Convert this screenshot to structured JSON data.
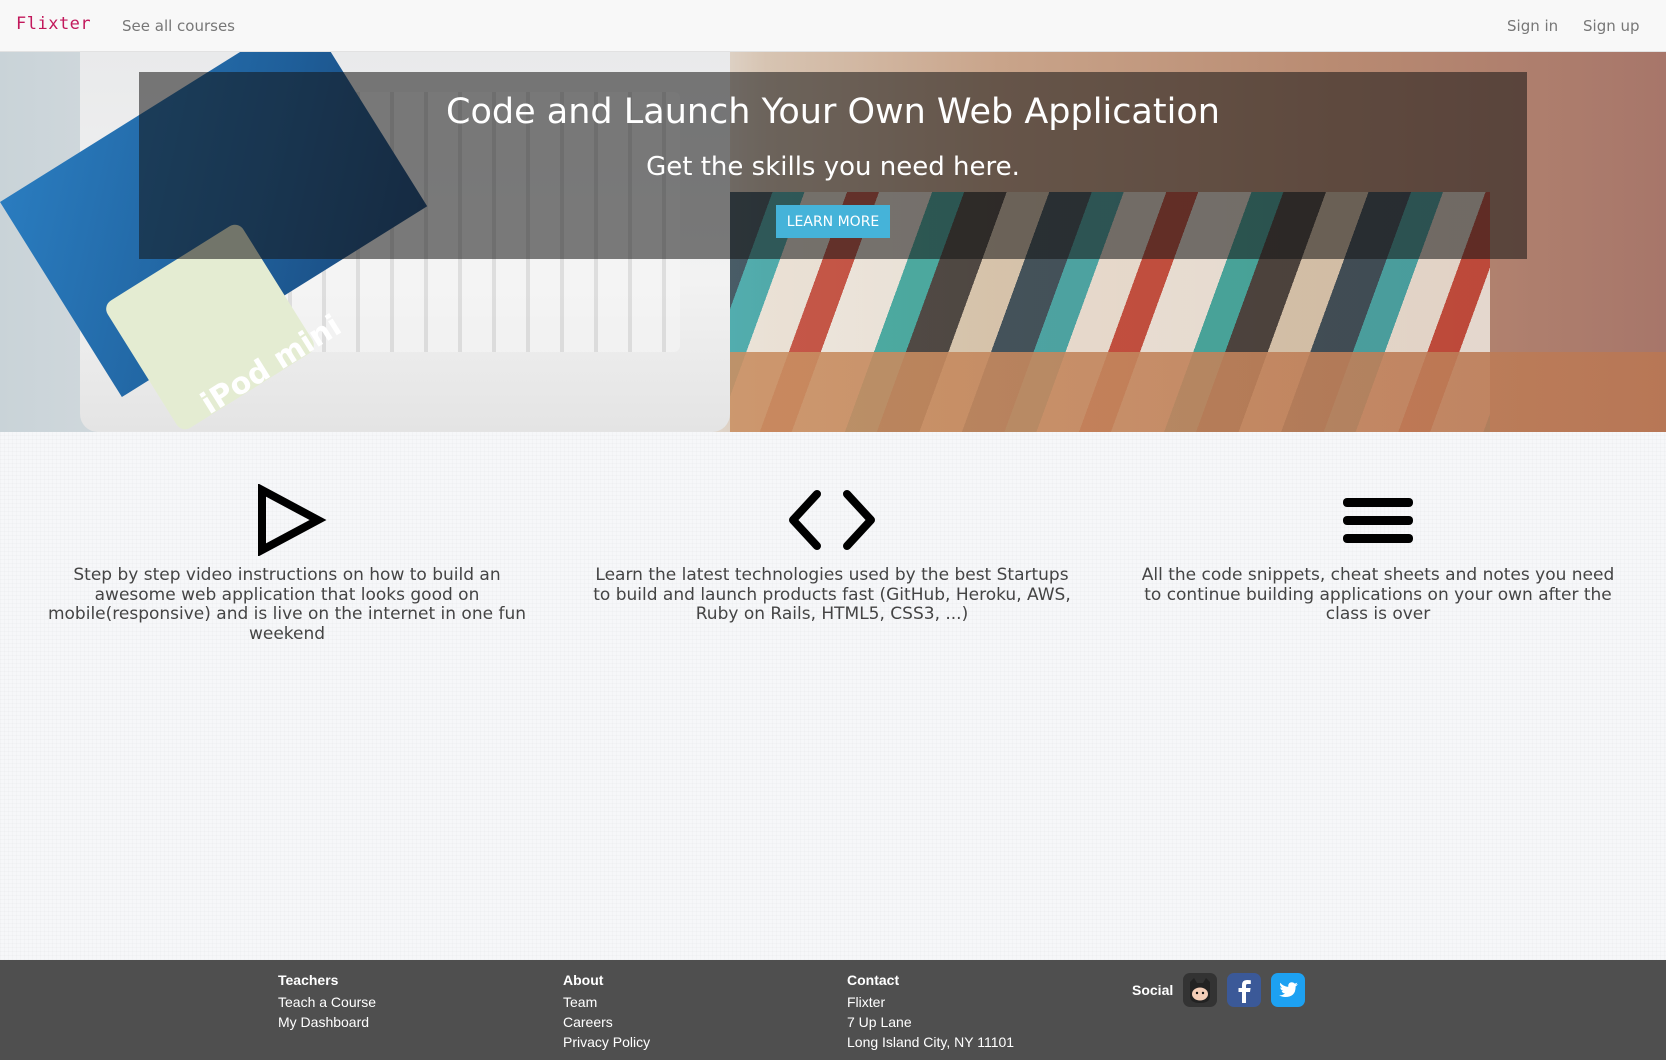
{
  "navbar": {
    "brand": "Flixter",
    "see_all_courses": "See all courses",
    "sign_in": "Sign in",
    "sign_up": "Sign up"
  },
  "hero": {
    "title": "Code and Launch Your Own Web Application",
    "subtitle": "Get the skills you need here.",
    "button_label": "LEARN MORE",
    "photo_text": "iPod mini"
  },
  "features": [
    {
      "icon": "play-icon",
      "text": "Step by step video instructions on how to build an awesome web application that looks good on mobile(responsive) and is live on the internet in one fun weekend"
    },
    {
      "icon": "code-icon",
      "text": "Learn the latest technologies used by the best Startups to build and launch products fast (GitHub, Heroku, AWS, Ruby on Rails, HTML5, CSS3, ...)"
    },
    {
      "icon": "menu-lines-icon",
      "text": "All the code snippets, cheat sheets and notes you need to continue building applications on your own after the class is over"
    }
  ],
  "footer": {
    "teachers": {
      "heading": "Teachers",
      "links": [
        "Teach a Course",
        "My Dashboard"
      ]
    },
    "about": {
      "heading": "About",
      "links": [
        "Team",
        "Careers",
        "Privacy Policy"
      ]
    },
    "contact": {
      "heading": "Contact",
      "lines": [
        "Flixter",
        "7 Up Lane",
        "Long Island City, NY 11101"
      ]
    },
    "social": {
      "label": "Social",
      "icons": [
        "github-icon",
        "facebook-icon",
        "twitter-icon"
      ]
    }
  },
  "colors": {
    "brand": "#c2185b",
    "button": "#45b3d9",
    "footer_bg": "#4f4f4f",
    "facebook": "#3b5998",
    "twitter": "#1da1f2"
  }
}
